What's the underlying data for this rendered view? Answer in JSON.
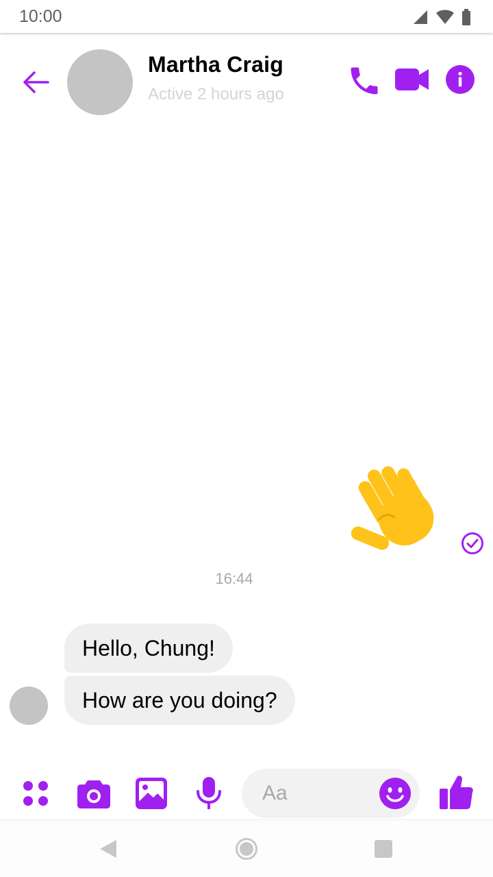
{
  "status_bar": {
    "time": "10:00",
    "icons": [
      "cellular-signal-icon",
      "wifi-icon",
      "battery-icon"
    ]
  },
  "header": {
    "contact_name": "Martha Craig",
    "contact_status": "Active 2 hours ago",
    "actions": [
      "back-arrow-icon",
      "phone-icon",
      "video-camera-icon",
      "info-icon"
    ]
  },
  "conversation": {
    "sent_message": {
      "content": "waving-hand-emoji",
      "status_icon": "sent-check-icon"
    },
    "timestamp": "16:44",
    "received_messages": [
      {
        "text": "Hello, Chung!"
      },
      {
        "text": "How are you doing?"
      }
    ]
  },
  "composer": {
    "placeholder": "Aa",
    "actions": [
      "apps-icon",
      "camera-icon",
      "gallery-icon",
      "microphone-icon",
      "emoji-icon",
      "thumbs-up-icon"
    ]
  },
  "nav_bar": {
    "buttons": [
      "nav-back-icon",
      "nav-home-icon",
      "nav-recents-icon"
    ]
  },
  "colors": {
    "accent": "#a020f0",
    "bubble_background": "#efefef",
    "avatar_placeholder": "#c4c4c4",
    "muted_text": "#a8a8a8"
  }
}
